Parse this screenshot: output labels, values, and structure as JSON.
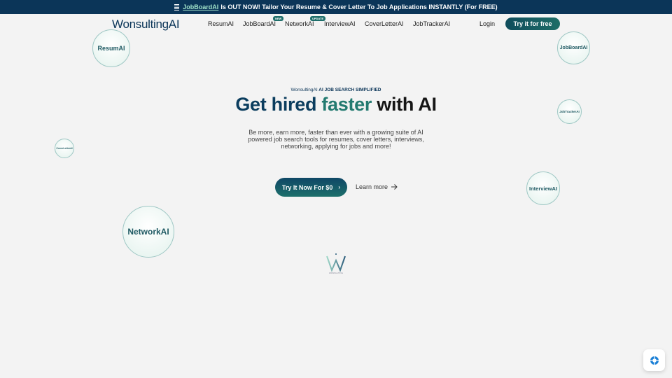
{
  "announcement": {
    "icon": "document-icon",
    "link_text": "JobBoardAI",
    "text": "Is OUT NOW! Tailor Your Resume & Cover Letter To Job Applications INSTANTLY (For FREE)"
  },
  "nav": {
    "logo": "WonsultingAI",
    "items": [
      {
        "label": "ResumAI",
        "badge": null
      },
      {
        "label": "JobBoardAI",
        "badge": "NEW"
      },
      {
        "label": "NetworkAI",
        "badge": "UPDATE"
      },
      {
        "label": "InterviewAI",
        "badge": null
      },
      {
        "label": "CoverLetterAI",
        "badge": null
      },
      {
        "label": "JobTrackerAI",
        "badge": null
      }
    ],
    "login": "Login",
    "cta": "Try it for free"
  },
  "hero": {
    "eyebrow_logo": "WonsultingAI",
    "eyebrow_text": "AI JOB SEARCH SIMPLIFIED",
    "headline_part1": "Get hired",
    "headline_part2": "faster",
    "headline_part3": "with AI",
    "subtitle": "Be more, earn more, faster than ever with a growing suite of AI powered job search tools for resumes, cover letters, interviews, networking, applying for jobs and more!",
    "primary_cta": "Try It Now For $0",
    "secondary_cta": "Learn more"
  },
  "bubbles": [
    "ResumAI",
    "JobBoardAI",
    "JobTrackerAI",
    "CoverLetterAI",
    "InterviewAI",
    "NetworkAI"
  ],
  "footer_mark": {
    "caption": "WONSULTING"
  },
  "colors": {
    "brand_navy": "#0b3558",
    "brand_teal": "#237a70",
    "help_blue": "#1a7fd6"
  }
}
